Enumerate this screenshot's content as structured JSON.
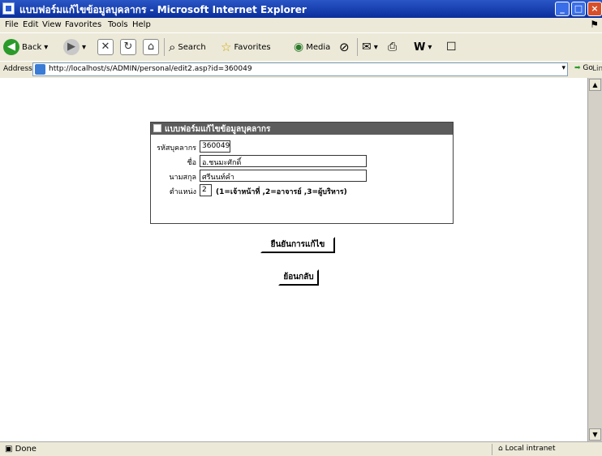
{
  "window": {
    "title": "แบบฟอร์มแก้ไขข้อมูลบุคลากร - Microsoft Internet Explorer",
    "min": "_",
    "max": "□",
    "close": "×"
  },
  "menu": {
    "file": "File",
    "edit": "Edit",
    "view": "View",
    "favorites": "Favorites",
    "tools": "Tools",
    "help": "Help"
  },
  "toolbar": {
    "back": "Back",
    "search": "Search",
    "favorites": "Favorites",
    "media": "Media"
  },
  "address": {
    "label": "Address",
    "url": "http://localhost/s/ADMIN/personal/edit2.asp?id=360049",
    "go": "Go",
    "links": "Links"
  },
  "form": {
    "header": "แบบฟอร์มแก้ไขข้อมูลบุคลากร",
    "fields": {
      "id_label": "รหัสบุคลากร",
      "id_value": "360049",
      "name_label": "ชื่อ",
      "name_value": "อ.ชนมะศักดิ์",
      "surname_label": "นามสกุล",
      "surname_value": "ศรีนนท์คำ",
      "position_label": "ตำแหน่ง",
      "position_value": "2",
      "position_hint": "(1=เจ้าหน้าที่ ,2=อาจารย์ ,3=ผู้บริหาร)"
    },
    "save_label": "ยืนยันการแก้ไข",
    "back_label": "ย้อนกลับ"
  },
  "status": {
    "text": "Done",
    "zone": "Local intranet"
  },
  "colors": {
    "titlebar": "#0a2e9c",
    "chrome": "#ece9d8",
    "form_header": "#5c5c5c"
  }
}
